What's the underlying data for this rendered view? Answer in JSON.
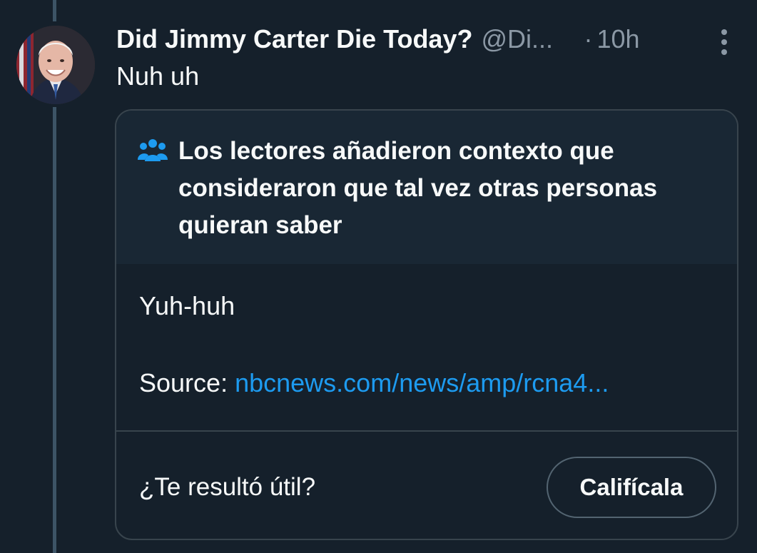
{
  "tweet": {
    "display_name": "Did Jimmy Carter Die Today?",
    "handle": "@Di...",
    "separator": "·",
    "time": "10h",
    "text": "Nuh uh"
  },
  "community_note": {
    "title": "Los lectores añadieron contexto que consideraron que tal vez otras personas quieran saber",
    "body": "Yuh-huh",
    "source_label": "Source:",
    "source_link": "nbcnews.com/news/amp/rcna4...",
    "helpful_prompt": "¿Te resultó útil?",
    "rate_button": "Califícala"
  },
  "icons": {
    "more": "more-vertical-icon",
    "note": "users-icon"
  },
  "colors": {
    "background": "#15202b",
    "note_header": "#192734",
    "link": "#1d9bf0",
    "secondary_text": "#8b98a5",
    "border": "#38444d"
  }
}
